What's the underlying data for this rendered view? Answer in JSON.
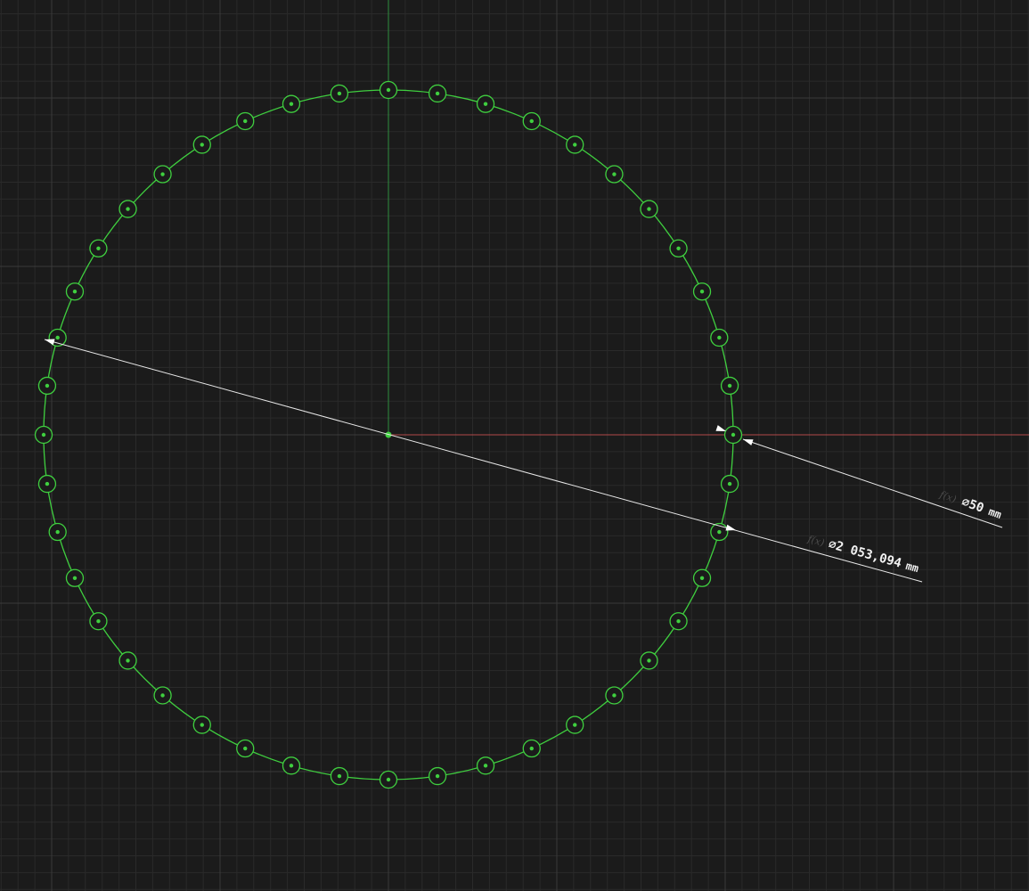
{
  "colors": {
    "background": "#1b1b1b",
    "grid_minor": "#2a2a2a",
    "grid_major": "#3a3a3a",
    "sketch_geometry": "#3fcf3f",
    "axis_vertical": "#2f8f3f",
    "axis_horizontal": "#b24a4a",
    "dimension_line": "#e8e8e8",
    "fx_label": "#4a4a4a"
  },
  "sketch": {
    "pattern_hole_count": 44
  },
  "dimensions": {
    "hole_diameter": {
      "fx_label": "f(x)",
      "value": "⌀50",
      "unit": "mm"
    },
    "circle_diameter": {
      "fx_label": "f(x)",
      "value": "⌀2 053,094",
      "unit": "mm"
    }
  },
  "icons": {
    "center_point": "origin-point-icon",
    "dimension_arrow": "dimension-arrow-icon"
  }
}
